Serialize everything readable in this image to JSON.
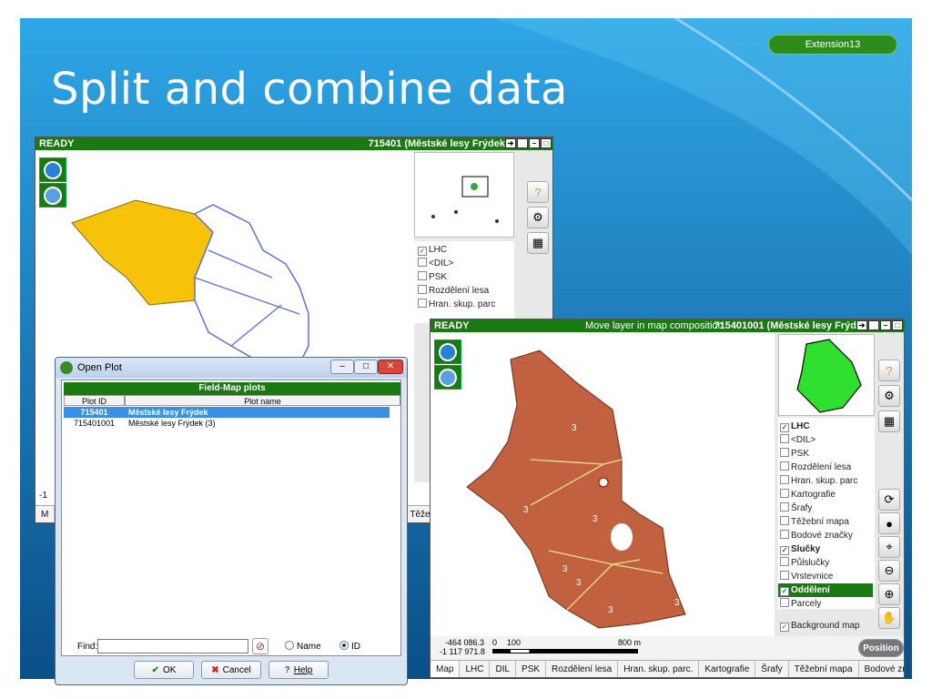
{
  "slide": {
    "title": "Split and combine data",
    "badge": "Extension13"
  },
  "window1": {
    "status": "READY",
    "title": "715401 (Městské lesy Frýdek",
    "layers": [
      {
        "name": "LHC",
        "checked": true
      },
      {
        "name": "<DIL>",
        "checked": false
      },
      {
        "name": "PSK",
        "checked": false
      },
      {
        "name": "Rozdělení lesa",
        "checked": false
      },
      {
        "name": "Hran. skup. parc",
        "checked": false
      }
    ],
    "coord_partial": "-1",
    "tab_partial": "M",
    "tab_partial_right": "Těže"
  },
  "window2": {
    "status": "READY",
    "message": "Move layer in map composition",
    "title": "715401001 (Městské lesy Frýd",
    "layers": [
      {
        "name": "LHC",
        "checked": true
      },
      {
        "name": "<DIL>",
        "checked": false
      },
      {
        "name": "PSK",
        "checked": false
      },
      {
        "name": "Rozdělení lesa",
        "checked": false
      },
      {
        "name": "Hran. skup. parc",
        "checked": false
      },
      {
        "name": "Kartografie",
        "checked": false
      },
      {
        "name": "Šrafy",
        "checked": false
      },
      {
        "name": "Těžební mapa",
        "checked": false
      },
      {
        "name": "Bodové značky",
        "checked": false
      },
      {
        "name": "Slučky",
        "checked": true
      },
      {
        "name": "Půlslučky",
        "checked": false
      },
      {
        "name": "Vrstevnice",
        "checked": false
      },
      {
        "name": "Oddělení",
        "checked": true
      },
      {
        "name": "Parcely",
        "checked": false
      }
    ],
    "background_map": "Background map",
    "position_button": "Position",
    "coord_x": "-464 086.3",
    "coord_y": "-1 117 971.8",
    "scale_zero": "0",
    "scale_mid": "100",
    "scale_end": "800 m",
    "tabs": [
      "Map",
      "LHC",
      "DIL",
      "PSK",
      "Rozdělení lesa",
      "Hran. skup. parc.",
      "Kartografie",
      "Šrafy",
      "Těžební mapa",
      "Bodové znač"
    ],
    "active_tab": "Map"
  },
  "dialog": {
    "title": "Open Plot",
    "header": "Field-Map plots",
    "col_id": "Plot ID",
    "col_name": "Plot name",
    "rows": [
      {
        "id": "715401",
        "name": "Městské lesy Frýdek"
      },
      {
        "id": "715401001",
        "name": "Městské lesy Frýdek (3)"
      }
    ],
    "find_label": "Find:",
    "radio_name": "Name",
    "radio_id": "ID",
    "ok": "OK",
    "cancel": "Cancel",
    "help": "Help"
  },
  "map_labels": [
    "3",
    "3",
    "3",
    "3",
    "3",
    "3",
    "3",
    "3"
  ]
}
